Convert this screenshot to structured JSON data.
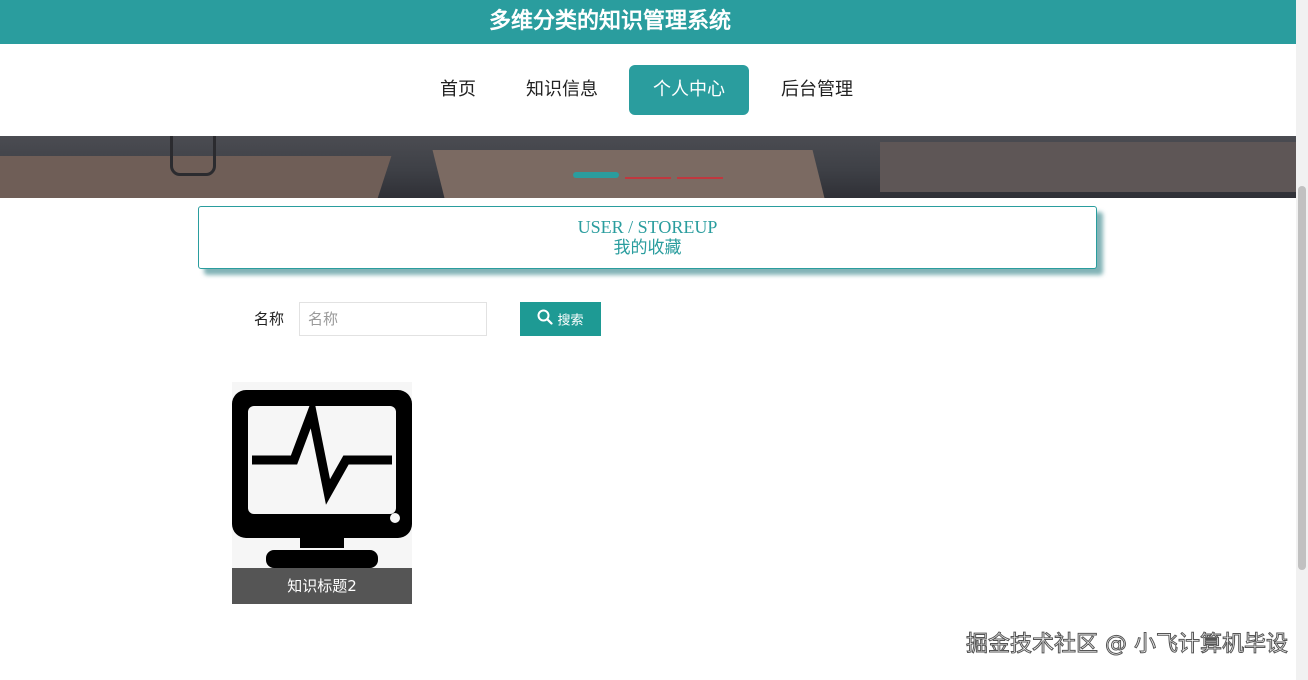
{
  "colors": {
    "accent": "#2a9d9e",
    "search_button": "#1e9a94",
    "caption_bg": "#555555"
  },
  "header": {
    "title": "多维分类的知识管理系统"
  },
  "nav": {
    "items": [
      {
        "label": "首页",
        "active": false
      },
      {
        "label": "知识信息",
        "active": false
      },
      {
        "label": "个人中心",
        "active": true
      },
      {
        "label": "后台管理",
        "active": false
      }
    ]
  },
  "section": {
    "title_en": "USER / STOREUP",
    "title_cn": "我的收藏"
  },
  "search": {
    "label": "名称",
    "placeholder": "名称",
    "value": "",
    "button_label": "搜索",
    "button_icon": "search-icon"
  },
  "items": [
    {
      "title": "知识标题2",
      "image_icon": "monitor-heartbeat-icon"
    }
  ],
  "watermark": "掘金技术社区 @ 小飞计算机毕设"
}
